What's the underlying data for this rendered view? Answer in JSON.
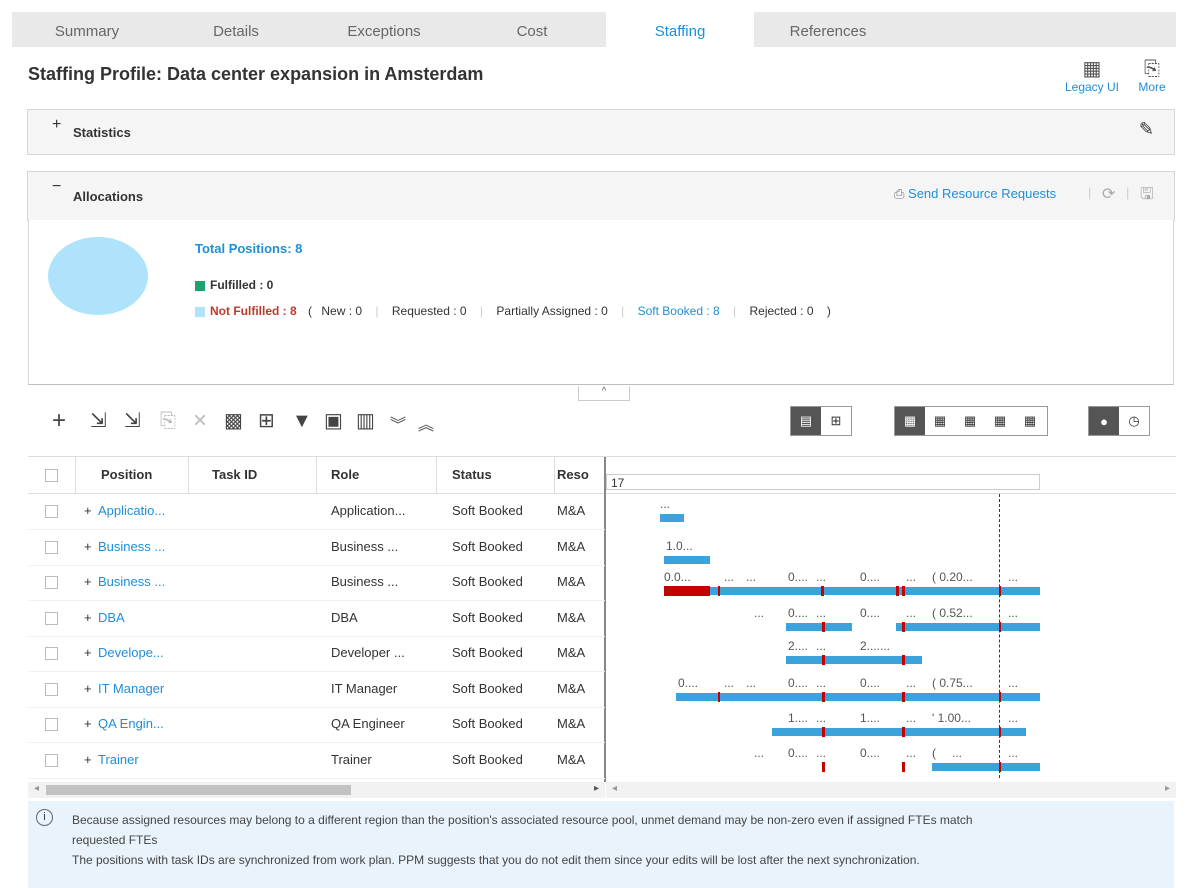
{
  "tabs": [
    {
      "label": "Summary"
    },
    {
      "label": "Details"
    },
    {
      "label": "Exceptions"
    },
    {
      "label": "Cost"
    },
    {
      "label": "Staffing"
    },
    {
      "label": "References"
    }
  ],
  "page_title": "Staffing Profile: Data center expansion in Amsterdam",
  "header_actions": {
    "legacy_label": "Legacy UI",
    "more_label": "More"
  },
  "statistics": {
    "sign": "+",
    "title": "Statistics"
  },
  "allocations": {
    "sign": "−",
    "title": "Allocations",
    "send_requests": "Send Resource Requests",
    "total_label": "Total Positions: 8",
    "fulfilled_label": "Fulfilled : 0",
    "not_fulfilled_label": "Not Fulfilled : 8",
    "open_paren": "(",
    "close_paren": ")",
    "breakdown": {
      "new": "New : 0",
      "requested": "Requested : 0",
      "partially": "Partially Assigned : 0",
      "soft_booked": "Soft Booked : 8",
      "rejected": "Rejected : 0"
    },
    "colors": {
      "fulfilled": "#1aa36b",
      "not_fulfilled": "#aee3fb",
      "not_fulfilled_text": "#c0392b",
      "pie": "#aee3fb"
    }
  },
  "grid": {
    "headers": {
      "position": "Position",
      "task_id": "Task ID",
      "role": "Role",
      "status": "Status",
      "resource": "Reso"
    },
    "timeline_label": "17",
    "rows": [
      {
        "position": "Applicatio...",
        "role": "Application...",
        "status": "Soft Booked",
        "resource": "M&A"
      },
      {
        "position": "Business ...",
        "role": "Business ...",
        "status": "Soft Booked",
        "resource": "M&A"
      },
      {
        "position": "Business ...",
        "role": "Business ...",
        "status": "Soft Booked",
        "resource": "M&A"
      },
      {
        "position": "DBA",
        "role": "DBA",
        "status": "Soft Booked",
        "resource": "M&A"
      },
      {
        "position": "Develope...",
        "role": "Developer ...",
        "status": "Soft Booked",
        "resource": "M&A"
      },
      {
        "position": "IT Manager",
        "role": "IT Manager",
        "status": "Soft Booked",
        "resource": "M&A"
      },
      {
        "position": "QA Engin...",
        "role": "QA Engineer",
        "status": "Soft Booked",
        "resource": "M&A"
      },
      {
        "position": "Trainer",
        "role": "Trainer",
        "status": "Soft Booked",
        "resource": "M&A"
      }
    ],
    "gantt_labels": [
      [
        "..."
      ],
      [
        "1.0..."
      ],
      [
        "0.0...",
        "...",
        "...",
        "0....",
        "...",
        "0....",
        "...",
        "( 0.20...",
        "..."
      ],
      [
        "...",
        "0....",
        "...",
        "0....",
        "...",
        "( 0.52...",
        "..."
      ],
      [
        "2....",
        "...",
        "2....",
        "..."
      ],
      [
        "0....",
        "...",
        "...",
        "0....",
        "...",
        "0....",
        "...",
        "( 0.75...",
        "..."
      ],
      [
        "1....",
        "...",
        "1....",
        "...",
        "' 1.00...",
        "..."
      ],
      [
        "...",
        "0....",
        "...",
        "0....",
        "...",
        "(",
        "...",
        "..."
      ]
    ]
  },
  "info": {
    "line1": "Because assigned resources may belong to a different region than the position's associated resource pool, unmet demand may be non-zero even if assigned FTEs match",
    "line2": "requested FTEs",
    "line3": "The positions with task IDs are synchronized from work plan. PPM suggests that you do not edit them since your edits will be lost after the next synchronization."
  }
}
